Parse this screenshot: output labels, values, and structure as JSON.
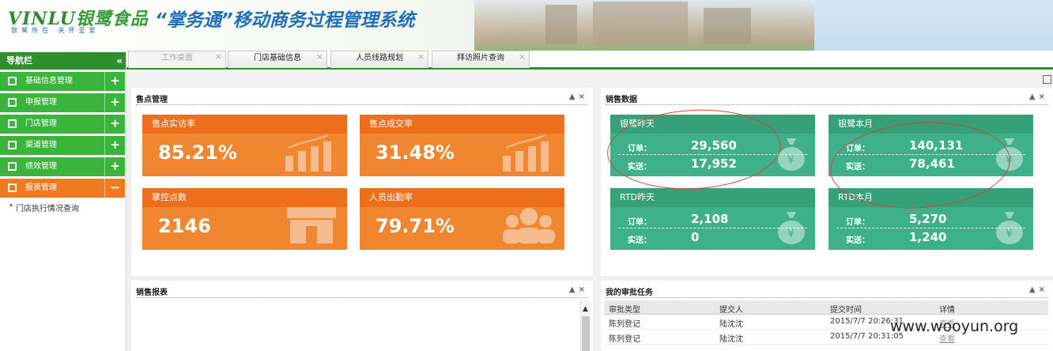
{
  "header": {
    "logo_text": "VINLU",
    "logo_cn": "银鹭食品",
    "slogan": "银鹭所在 关怀至爱",
    "system_title": "“掌务通”移动商务过程管理系统"
  },
  "nav": {
    "title": "导航栏",
    "collapse_icon": "«",
    "items": [
      {
        "label": "基础信息管理",
        "toggle": "+"
      },
      {
        "label": "申报管理",
        "toggle": "+"
      },
      {
        "label": "门店管理",
        "toggle": "+"
      },
      {
        "label": "渠道管理",
        "toggle": "+"
      },
      {
        "label": "绩效管理",
        "toggle": "+"
      },
      {
        "label": "报表管理",
        "toggle": "−"
      }
    ],
    "subitem": "门店执行情况查询"
  },
  "tabs": [
    {
      "label": "工作桌面",
      "close": "×"
    },
    {
      "label": "门店基础信息",
      "close": "×"
    },
    {
      "label": "人员线路规划",
      "close": "×"
    },
    {
      "label": "拜访照片查询",
      "close": "×"
    }
  ],
  "panels": {
    "sales_points": {
      "title": "售点管理",
      "controls": "▲×",
      "cards": [
        {
          "label": "售点实访率",
          "value": "85.21%"
        },
        {
          "label": "售点成交率",
          "value": "31.48%"
        },
        {
          "label": "掌控点数",
          "value": "2146"
        },
        {
          "label": "人员出勤率",
          "value": "79.71%"
        }
      ]
    },
    "sales_data": {
      "title": "销售数据",
      "controls": "▲×",
      "order_label": "订单：",
      "ship_label": "实送：",
      "cards": [
        {
          "label": "银鹭昨天",
          "order": "29,560",
          "ship": "17,952"
        },
        {
          "label": "银鹭本月",
          "order": "140,131",
          "ship": "78,461"
        },
        {
          "label": "RTD昨天",
          "order": "2,108",
          "ship": "0"
        },
        {
          "label": "RTD本月",
          "order": "5,270",
          "ship": "1,240"
        }
      ]
    },
    "sales_report": {
      "title": "销售报表",
      "controls": "▲×"
    },
    "approvals": {
      "title": "我的审批任务",
      "controls": "▲×",
      "columns": [
        "审批类型",
        "提交人",
        "提交时间",
        "详情"
      ],
      "rows": [
        [
          "陈列登记",
          "陆沈沈",
          "2015/7/7 20:26:31",
          "查看"
        ],
        [
          "陈列登记",
          "陆沈沈",
          "2015/7/7 20:31:05",
          "查看"
        ]
      ]
    }
  },
  "watermark": "www.wooyun.org",
  "colors": {
    "green": "#3ab43a",
    "orange": "#f0862f",
    "teal": "#3fb18a",
    "title_blue": "#1f6fb8"
  }
}
